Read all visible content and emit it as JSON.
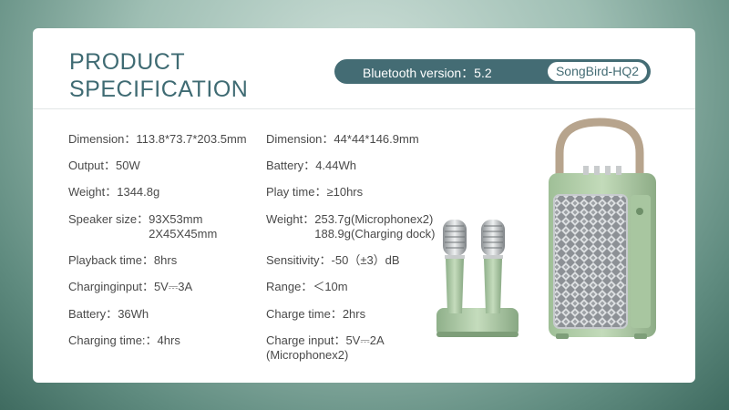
{
  "title": {
    "line1": "PRODUCT",
    "line2": "SPECIFICATION"
  },
  "pill": {
    "bluetooth": "Bluetooth version：5.2",
    "model": "SongBird-HQ2"
  },
  "speaker_specs": [
    {
      "label": "Dimension：",
      "value": "113.8*73.7*203.5mm"
    },
    {
      "label": "Output：",
      "value": "50W"
    },
    {
      "label": "Weight：",
      "value": "1344.8g"
    },
    {
      "label": "Speaker size：",
      "value": "93X53mm",
      "value2": "2X45X45mm"
    },
    {
      "label": "Playback time：",
      "value": "8hrs"
    },
    {
      "label": "Charginginput：",
      "value": "5V⎓3A"
    },
    {
      "label": "Battery：",
      "value": "36Wh"
    },
    {
      "label": "Charging time:：",
      "value": "4hrs"
    }
  ],
  "mic_specs": [
    {
      "label": "Dimension：",
      "value": "44*44*146.9mm"
    },
    {
      "label": "Battery：",
      "value": "4.44Wh"
    },
    {
      "label": "Play time：",
      "value": "≥10hrs"
    },
    {
      "label": "Weight：",
      "value": "253.7g(Microphonex2)",
      "value2": "188.9g(Charging dock)"
    },
    {
      "label": "Sensitivity：",
      "value": "-50（±3）dB"
    },
    {
      "label": "Range：",
      "value": "＜10m"
    },
    {
      "label": "Charge time：",
      "value": "2hrs"
    },
    {
      "label": "Charge input：",
      "value": "5V⎓2A",
      "value2": "(Microphonex2)"
    }
  ],
  "colors": {
    "accent": "#446c74",
    "title": "#3f6b73",
    "product_green": "#a9c8a0"
  },
  "icons": {
    "microphones": "microphone-set-image",
    "speaker": "speaker-image"
  }
}
